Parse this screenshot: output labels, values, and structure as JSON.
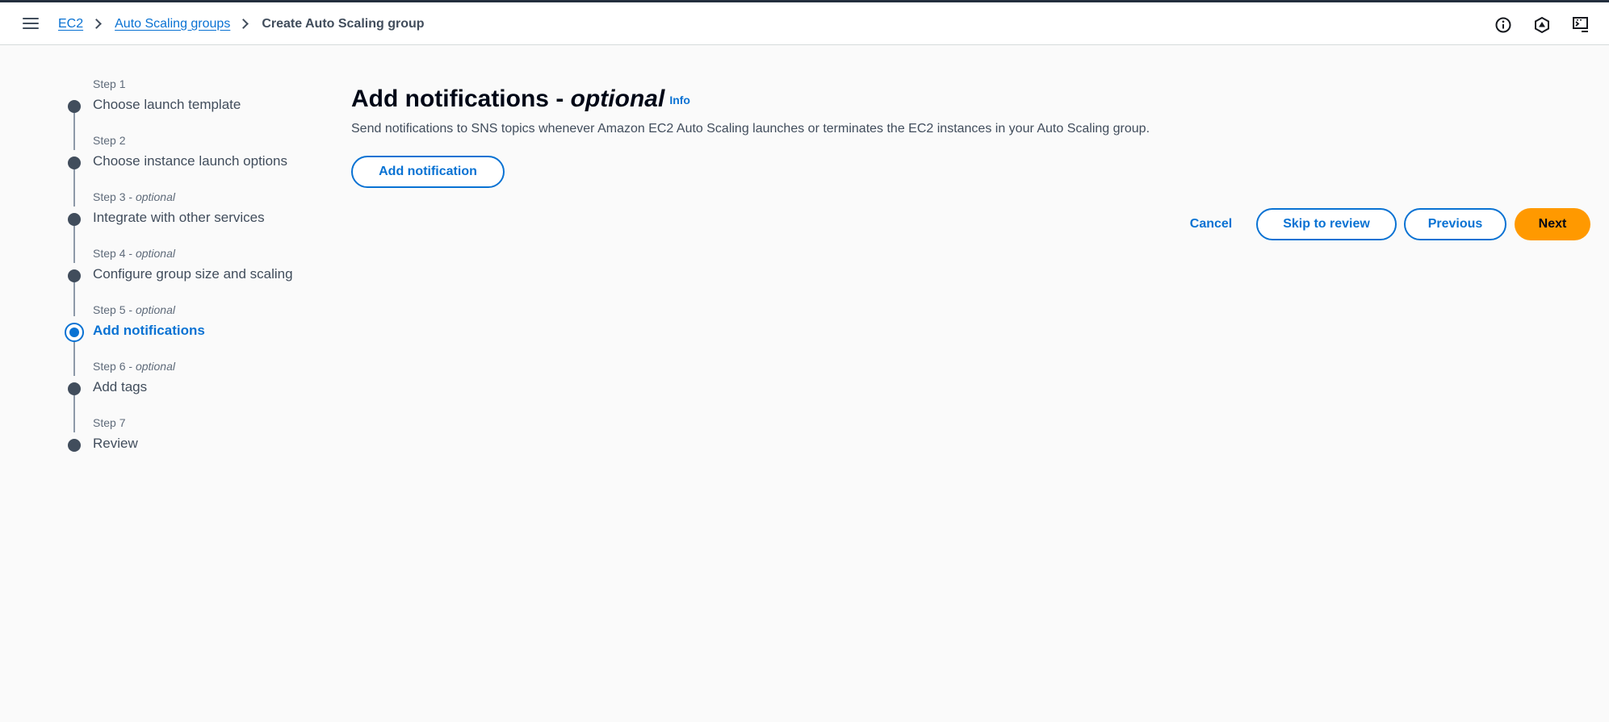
{
  "breadcrumb": {
    "items": [
      "EC2",
      "Auto Scaling groups"
    ],
    "current": "Create Auto Scaling group"
  },
  "header_icons": [
    "info-circle-icon",
    "settings-hex-icon",
    "cloudshell-icon"
  ],
  "steps": [
    {
      "number": "Step 1",
      "optional": "",
      "title": "Choose launch template",
      "active": false
    },
    {
      "number": "Step 2",
      "optional": "",
      "title": "Choose instance launch options",
      "active": false
    },
    {
      "number": "Step 3",
      "optional": "optional",
      "title": "Integrate with other services",
      "active": false
    },
    {
      "number": "Step 4",
      "optional": "optional",
      "title": "Configure group size and scaling",
      "active": false
    },
    {
      "number": "Step 5",
      "optional": "optional",
      "title": "Add notifications",
      "active": true
    },
    {
      "number": "Step 6",
      "optional": "optional",
      "title": "Add tags",
      "active": false
    },
    {
      "number": "Step 7",
      "optional": "",
      "title": "Review",
      "active": false
    }
  ],
  "page": {
    "title": "Add notifications -",
    "title_optional": "optional",
    "info": "Info",
    "description": "Send notifications to SNS topics whenever Amazon EC2 Auto Scaling launches or terminates the EC2 instances in your Auto Scaling group.",
    "add_notification": "Add notification"
  },
  "actions": {
    "cancel": "Cancel",
    "skip": "Skip to review",
    "previous": "Previous",
    "next": "Next"
  },
  "colors": {
    "accent": "#0972d3",
    "primary_button": "#ff9900",
    "step_dot": "#414d5c"
  }
}
